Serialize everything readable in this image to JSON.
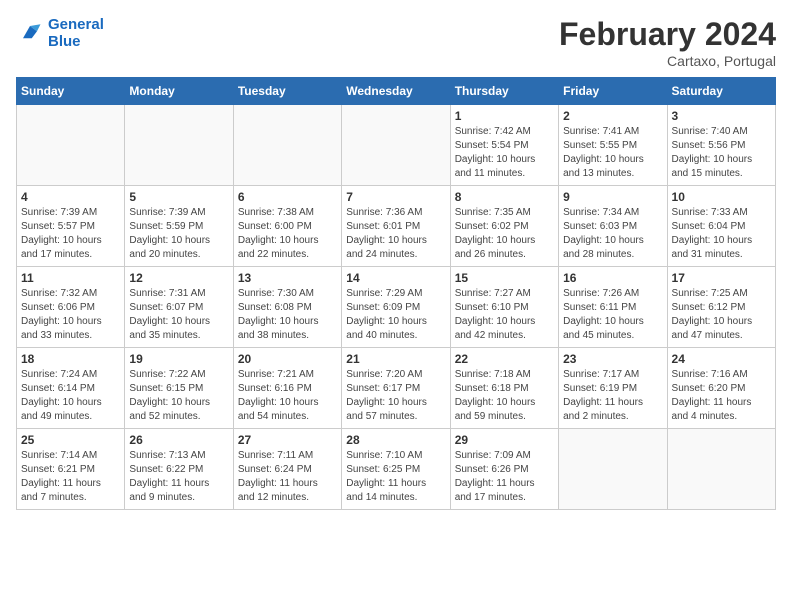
{
  "header": {
    "logo_line1": "General",
    "logo_line2": "Blue",
    "month_year": "February 2024",
    "location": "Cartaxo, Portugal"
  },
  "weekdays": [
    "Sunday",
    "Monday",
    "Tuesday",
    "Wednesday",
    "Thursday",
    "Friday",
    "Saturday"
  ],
  "weeks": [
    [
      {
        "day": "",
        "info": ""
      },
      {
        "day": "",
        "info": ""
      },
      {
        "day": "",
        "info": ""
      },
      {
        "day": "",
        "info": ""
      },
      {
        "day": "1",
        "info": "Sunrise: 7:42 AM\nSunset: 5:54 PM\nDaylight: 10 hours\nand 11 minutes."
      },
      {
        "day": "2",
        "info": "Sunrise: 7:41 AM\nSunset: 5:55 PM\nDaylight: 10 hours\nand 13 minutes."
      },
      {
        "day": "3",
        "info": "Sunrise: 7:40 AM\nSunset: 5:56 PM\nDaylight: 10 hours\nand 15 minutes."
      }
    ],
    [
      {
        "day": "4",
        "info": "Sunrise: 7:39 AM\nSunset: 5:57 PM\nDaylight: 10 hours\nand 17 minutes."
      },
      {
        "day": "5",
        "info": "Sunrise: 7:39 AM\nSunset: 5:59 PM\nDaylight: 10 hours\nand 20 minutes."
      },
      {
        "day": "6",
        "info": "Sunrise: 7:38 AM\nSunset: 6:00 PM\nDaylight: 10 hours\nand 22 minutes."
      },
      {
        "day": "7",
        "info": "Sunrise: 7:36 AM\nSunset: 6:01 PM\nDaylight: 10 hours\nand 24 minutes."
      },
      {
        "day": "8",
        "info": "Sunrise: 7:35 AM\nSunset: 6:02 PM\nDaylight: 10 hours\nand 26 minutes."
      },
      {
        "day": "9",
        "info": "Sunrise: 7:34 AM\nSunset: 6:03 PM\nDaylight: 10 hours\nand 28 minutes."
      },
      {
        "day": "10",
        "info": "Sunrise: 7:33 AM\nSunset: 6:04 PM\nDaylight: 10 hours\nand 31 minutes."
      }
    ],
    [
      {
        "day": "11",
        "info": "Sunrise: 7:32 AM\nSunset: 6:06 PM\nDaylight: 10 hours\nand 33 minutes."
      },
      {
        "day": "12",
        "info": "Sunrise: 7:31 AM\nSunset: 6:07 PM\nDaylight: 10 hours\nand 35 minutes."
      },
      {
        "day": "13",
        "info": "Sunrise: 7:30 AM\nSunset: 6:08 PM\nDaylight: 10 hours\nand 38 minutes."
      },
      {
        "day": "14",
        "info": "Sunrise: 7:29 AM\nSunset: 6:09 PM\nDaylight: 10 hours\nand 40 minutes."
      },
      {
        "day": "15",
        "info": "Sunrise: 7:27 AM\nSunset: 6:10 PM\nDaylight: 10 hours\nand 42 minutes."
      },
      {
        "day": "16",
        "info": "Sunrise: 7:26 AM\nSunset: 6:11 PM\nDaylight: 10 hours\nand 45 minutes."
      },
      {
        "day": "17",
        "info": "Sunrise: 7:25 AM\nSunset: 6:12 PM\nDaylight: 10 hours\nand 47 minutes."
      }
    ],
    [
      {
        "day": "18",
        "info": "Sunrise: 7:24 AM\nSunset: 6:14 PM\nDaylight: 10 hours\nand 49 minutes."
      },
      {
        "day": "19",
        "info": "Sunrise: 7:22 AM\nSunset: 6:15 PM\nDaylight: 10 hours\nand 52 minutes."
      },
      {
        "day": "20",
        "info": "Sunrise: 7:21 AM\nSunset: 6:16 PM\nDaylight: 10 hours\nand 54 minutes."
      },
      {
        "day": "21",
        "info": "Sunrise: 7:20 AM\nSunset: 6:17 PM\nDaylight: 10 hours\nand 57 minutes."
      },
      {
        "day": "22",
        "info": "Sunrise: 7:18 AM\nSunset: 6:18 PM\nDaylight: 10 hours\nand 59 minutes."
      },
      {
        "day": "23",
        "info": "Sunrise: 7:17 AM\nSunset: 6:19 PM\nDaylight: 11 hours\nand 2 minutes."
      },
      {
        "day": "24",
        "info": "Sunrise: 7:16 AM\nSunset: 6:20 PM\nDaylight: 11 hours\nand 4 minutes."
      }
    ],
    [
      {
        "day": "25",
        "info": "Sunrise: 7:14 AM\nSunset: 6:21 PM\nDaylight: 11 hours\nand 7 minutes."
      },
      {
        "day": "26",
        "info": "Sunrise: 7:13 AM\nSunset: 6:22 PM\nDaylight: 11 hours\nand 9 minutes."
      },
      {
        "day": "27",
        "info": "Sunrise: 7:11 AM\nSunset: 6:24 PM\nDaylight: 11 hours\nand 12 minutes."
      },
      {
        "day": "28",
        "info": "Sunrise: 7:10 AM\nSunset: 6:25 PM\nDaylight: 11 hours\nand 14 minutes."
      },
      {
        "day": "29",
        "info": "Sunrise: 7:09 AM\nSunset: 6:26 PM\nDaylight: 11 hours\nand 17 minutes."
      },
      {
        "day": "",
        "info": ""
      },
      {
        "day": "",
        "info": ""
      }
    ]
  ]
}
